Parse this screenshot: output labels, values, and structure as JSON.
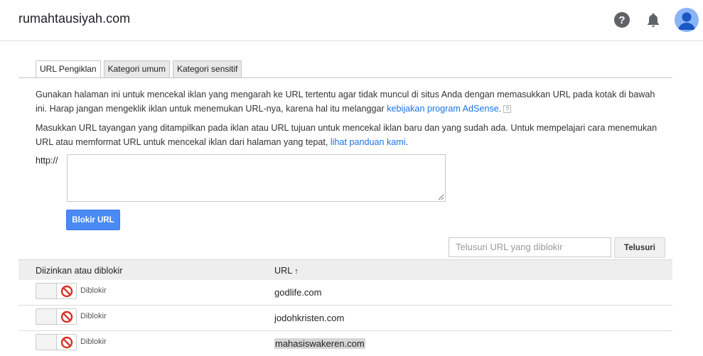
{
  "header": {
    "site_name": "rumahtausiyah.com",
    "icons": [
      "help-icon",
      "notifications-icon",
      "account-icon"
    ]
  },
  "tabs": [
    {
      "label": "URL Pengiklan",
      "active": true
    },
    {
      "label": "Kategori umum",
      "active": false
    },
    {
      "label": "Kategori sensitif",
      "active": false
    }
  ],
  "intro": {
    "text1": "Gunakan halaman ini untuk mencekal iklan yang mengarah ke URL tertentu agar tidak muncul di situs Anda dengan memasukkan URL pada kotak di bawah ini. Harap jangan mengeklik iklan untuk menemukan URL-nya, karena hal itu melanggar ",
    "link1": "kebijakan program AdSense",
    "text1_end": ".",
    "help_glyph": "?",
    "text2": "Masukkan URL tayangan yang ditampilkan pada iklan atau URL tujuan untuk mencekal iklan baru dan yang sudah ada. Untuk mempelajari cara menemukan URL atau memformat URL untuk mencekal iklan dari halaman yang tepat, ",
    "link2": "lihat panduan kami",
    "text2_end": "."
  },
  "form": {
    "prefix_label": "http://",
    "textarea_value": "",
    "block_button": "Blokir URL"
  },
  "search": {
    "placeholder": "Telusuri URL yang diblokir",
    "button": "Telusuri"
  },
  "table": {
    "col_status": "Diizinkan atau diblokir",
    "col_url": "URL",
    "sort_glyph": "↑",
    "rows": [
      {
        "status": "Diblokir",
        "url": "godlife.com",
        "highlighted": false
      },
      {
        "status": "Diblokir",
        "url": "jodohkristen.com",
        "highlighted": false
      },
      {
        "status": "Diblokir",
        "url": "mahasiswakeren.com",
        "highlighted": true
      }
    ]
  },
  "colors": {
    "accent": "#4a8af4",
    "link": "#1a73e8",
    "blocked_icon": "#d93025"
  }
}
